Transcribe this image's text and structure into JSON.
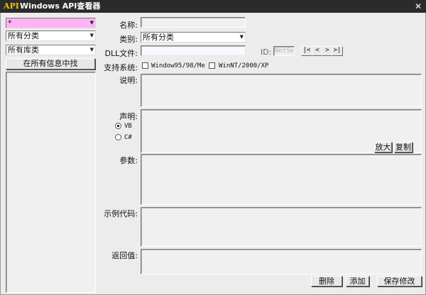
{
  "window": {
    "title": "Windows API查看器",
    "app_icon_text": "API",
    "close_symbol": "✕"
  },
  "left": {
    "search_value": "*",
    "search_highlight": "#ffb3f4",
    "category_value": "所有分类",
    "library_value": "所有库类",
    "search_all_button": "在所有信息中找"
  },
  "form": {
    "name_label": "名称:",
    "category_label": "类别:",
    "category_value": "所有分类",
    "dll_label": "DLL文件:",
    "id_label": "ID:",
    "id_value": "NotSet",
    "nav": {
      "first": "|<",
      "prev": "<",
      "next": ">",
      "last": ">|"
    },
    "support_label": "支持系统:",
    "os1": "Window95/98/Me",
    "os2": "WinNT/2000/XP",
    "desc_label": "说明:",
    "decl_label": "声明:",
    "radio_vb": "VB",
    "radio_cs": "C#",
    "zoom_button": "放大",
    "copy_button": "复制",
    "params_label": "参数:",
    "example_label": "示例代码:",
    "return_label": "返回值:",
    "delete_button": "删除",
    "add_button": "添加",
    "save_button": "保存修改"
  }
}
